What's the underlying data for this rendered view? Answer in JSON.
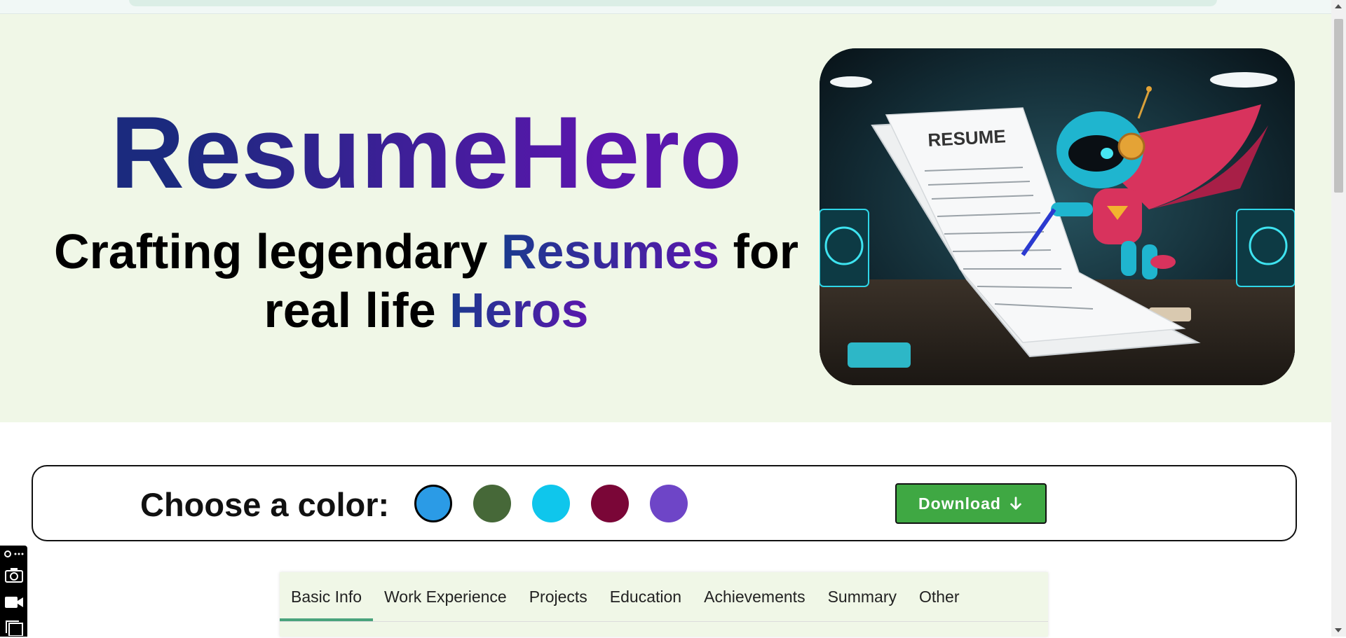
{
  "hero": {
    "title": "ResumeHero",
    "tagline": {
      "part1": "Crafting legendary ",
      "accent1": "Resumes",
      "part2": " for",
      "part3": "real life ",
      "accent2": "Heros"
    },
    "illustration": {
      "resume_heading": "RESUME"
    }
  },
  "color_picker": {
    "label": "Choose a color:",
    "swatches": [
      {
        "name": "blue",
        "color": "#2b9be6",
        "selected": true
      },
      {
        "name": "green",
        "color": "#466838",
        "selected": false
      },
      {
        "name": "cyan",
        "color": "#0fc6ec",
        "selected": false
      },
      {
        "name": "maroon",
        "color": "#7a0637",
        "selected": false
      },
      {
        "name": "purple",
        "color": "#6e45c7",
        "selected": false
      }
    ],
    "download_label": "Download"
  },
  "tabs": [
    {
      "label": "Basic Info",
      "active": true
    },
    {
      "label": "Work Experience",
      "active": false
    },
    {
      "label": "Projects",
      "active": false
    },
    {
      "label": "Education",
      "active": false
    },
    {
      "label": "Achievements",
      "active": false
    },
    {
      "label": "Summary",
      "active": false
    },
    {
      "label": "Other",
      "active": false
    }
  ],
  "icons": {
    "download": "arrow-down-icon",
    "side_tools": [
      "link-icon",
      "more-icon",
      "camera-icon",
      "video-icon",
      "window-icon"
    ]
  },
  "theme": {
    "hero_bg": "#f0f7e7",
    "brand_gradient_start": "#1b2a7e",
    "brand_gradient_end": "#5a16ad",
    "download_bg": "#3fa843",
    "tab_active_underline": "#4aa37c"
  }
}
